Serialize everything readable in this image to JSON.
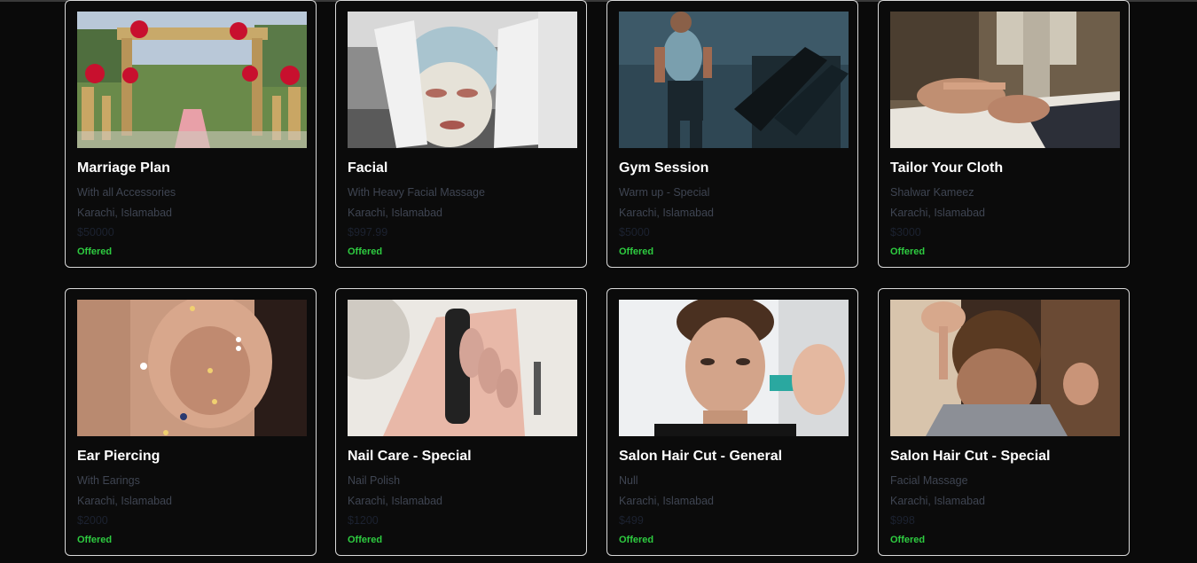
{
  "colors": {
    "background": "#0a0a0a",
    "card_border": "#d9d9d9",
    "title": "#ffffff",
    "muted_text": "#3f4552",
    "status": "#2ecc40"
  },
  "cards": [
    {
      "title": "Marriage Plan",
      "description": "With all Accessories",
      "location": "Karachi, Islamabad",
      "price": "$50000",
      "status": "Offered",
      "image": "wedding-stage-photo"
    },
    {
      "title": "Facial",
      "description": "With Heavy Facial Massage",
      "location": "Karachi, Islamabad",
      "price": "$997.99",
      "status": "Offered",
      "image": "facial-mask-photo"
    },
    {
      "title": "Gym Session",
      "description": "Warm up - Special",
      "location": "Karachi, Islamabad",
      "price": "$5000",
      "status": "Offered",
      "image": "treadmill-photo"
    },
    {
      "title": "Tailor Your Cloth",
      "description": "Shalwar Kameez",
      "location": "Karachi, Islamabad",
      "price": "$3000",
      "status": "Offered",
      "image": "sewing-machine-photo"
    },
    {
      "title": "Ear Piercing",
      "description": "With Earings",
      "location": "Karachi, Islamabad",
      "price": "$2000",
      "status": "Offered",
      "image": "ear-piercing-photo"
    },
    {
      "title": "Nail Care - Special",
      "description": "Nail Polish",
      "location": "Karachi, Islamabad",
      "price": "$1200",
      "status": "Offered",
      "image": "nail-polish-photo"
    },
    {
      "title": "Salon Hair Cut - General",
      "description": "Null",
      "location": "Karachi, Islamabad",
      "price": "$499",
      "status": "Offered",
      "image": "hair-cut-general-photo"
    },
    {
      "title": "Salon Hair Cut - Special",
      "description": "Facial Massage",
      "location": "Karachi, Islamabad",
      "price": "$998",
      "status": "Offered",
      "image": "hair-cut-special-photo"
    }
  ]
}
